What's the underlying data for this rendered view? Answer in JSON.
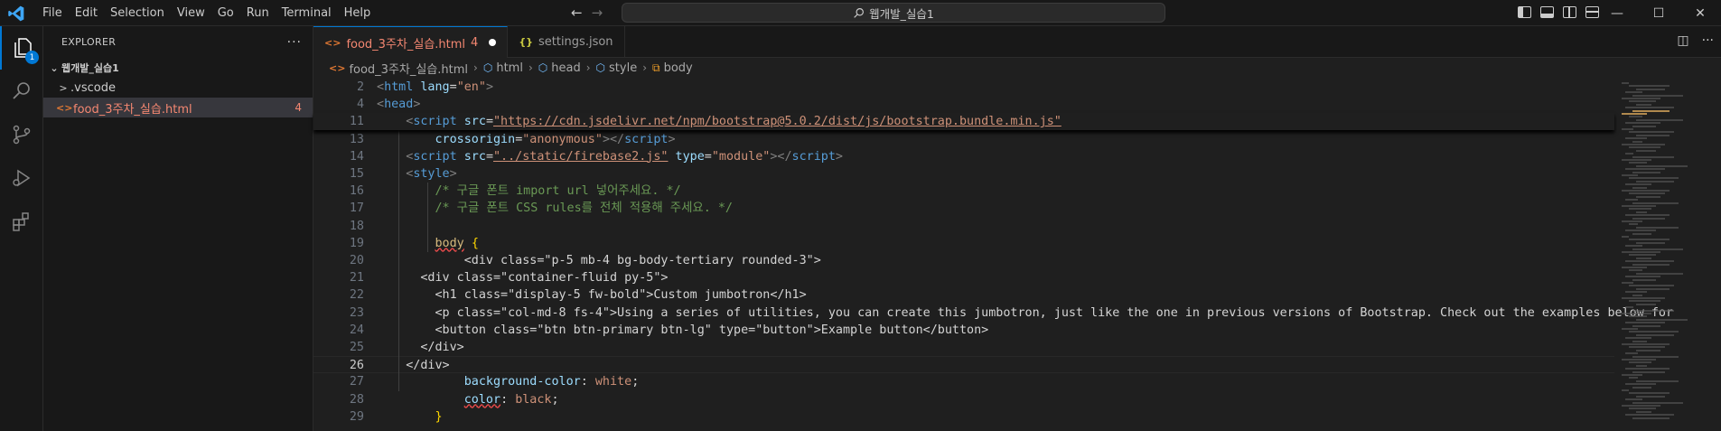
{
  "menu": [
    "File",
    "Edit",
    "Selection",
    "View",
    "Go",
    "Run",
    "Terminal",
    "Help"
  ],
  "search": {
    "label": "웹개발_실습1"
  },
  "window_controls": [
    "—",
    "☐",
    "✕"
  ],
  "activity": {
    "explorer_badge": "1"
  },
  "sidebar": {
    "title": "EXPLORER",
    "more": "···",
    "project": "웹개발_실습1",
    "items": [
      {
        "chevron": ">",
        "label": ".vscode",
        "count": ""
      },
      {
        "chevron": "<>",
        "label": "food_3주차_실습.html",
        "count": "4"
      }
    ]
  },
  "tabs": [
    {
      "icon": "<>",
      "label": "food_3주차_실습.html",
      "problems": "4"
    },
    {
      "icon": "{}",
      "label": "settings.json"
    }
  ],
  "breadcrumb": {
    "file": "food_3주차_실습.html",
    "parts": [
      "html",
      "head",
      "style",
      "body"
    ],
    "file_icon": "<>"
  },
  "editor": {
    "current_line": "26",
    "lines": [
      {
        "n": "2",
        "tokens": [
          [
            "t",
            "<"
          ],
          [
            "tag",
            "html"
          ],
          [
            "d",
            " "
          ],
          [
            "at",
            "lang"
          ],
          [
            "d",
            "="
          ],
          [
            "v",
            "\"en\""
          ],
          [
            "t",
            ">"
          ]
        ]
      },
      {
        "n": "4",
        "tokens": [
          [
            "t",
            "<"
          ],
          [
            "tag",
            "head"
          ],
          [
            "t",
            ">"
          ]
        ]
      },
      {
        "n": "11",
        "tokens": [
          [
            "d",
            "    "
          ],
          [
            "t",
            "<"
          ],
          [
            "tag",
            "script"
          ],
          [
            "d",
            " "
          ],
          [
            "at",
            "src"
          ],
          [
            "d",
            "="
          ],
          [
            "vl",
            "\"https://cdn.jsdelivr.net/npm/bootstrap@5.0.2/dist/js/bootstrap.bundle.min.js\""
          ]
        ]
      },
      {
        "n": "13",
        "tokens": [
          [
            "d",
            "        "
          ],
          [
            "at",
            "crossorigin"
          ],
          [
            "d",
            "="
          ],
          [
            "v",
            "\"anonymous\""
          ],
          [
            "t",
            "></"
          ],
          [
            "tag",
            "script"
          ],
          [
            "t",
            ">"
          ]
        ]
      },
      {
        "n": "14",
        "tokens": [
          [
            "d",
            "    "
          ],
          [
            "t",
            "<"
          ],
          [
            "tag",
            "script"
          ],
          [
            "d",
            " "
          ],
          [
            "at",
            "src"
          ],
          [
            "d",
            "="
          ],
          [
            "vl",
            "\"../static/firebase2.js\""
          ],
          [
            "d",
            " "
          ],
          [
            "at",
            "type"
          ],
          [
            "d",
            "="
          ],
          [
            "v",
            "\"module\""
          ],
          [
            "t",
            "></"
          ],
          [
            "tag",
            "script"
          ],
          [
            "t",
            ">"
          ]
        ]
      },
      {
        "n": "15",
        "tokens": [
          [
            "d",
            "    "
          ],
          [
            "t",
            "<"
          ],
          [
            "tag",
            "style"
          ],
          [
            "t",
            ">"
          ]
        ]
      },
      {
        "n": "16",
        "tokens": [
          [
            "d",
            "        "
          ],
          [
            "cm",
            "/* 구글 폰트 import url 넣어주세요. */"
          ]
        ]
      },
      {
        "n": "17",
        "tokens": [
          [
            "d",
            "        "
          ],
          [
            "cm",
            "/* 구글 폰트 CSS rules를 전체 적용해 주세요. */"
          ]
        ]
      },
      {
        "n": "18",
        "tokens": []
      },
      {
        "n": "19",
        "tokens": [
          [
            "d",
            "        "
          ],
          [
            "selq",
            "body"
          ],
          [
            "d",
            " "
          ],
          [
            "br",
            "{"
          ]
        ]
      },
      {
        "n": "20",
        "tokens": [
          [
            "d",
            "            <div class=\"p-5 mb-4 bg-body-tertiary rounded-3\">"
          ]
        ]
      },
      {
        "n": "21",
        "tokens": [
          [
            "d",
            "      <div class=\"container-fluid py-5\">"
          ]
        ]
      },
      {
        "n": "22",
        "tokens": [
          [
            "d",
            "        <h1 class=\"display-5 fw-bold\">Custom jumbotron</h1>"
          ]
        ]
      },
      {
        "n": "23",
        "tokens": [
          [
            "d",
            "        <p class=\"col-md-8 fs-4\">Using a series of utilities, you can create this jumbotron, just like the one in previous versions of Bootstrap. Check out the examples below for"
          ]
        ]
      },
      {
        "n": "24",
        "tokens": [
          [
            "d",
            "        <button class=\"btn btn-primary btn-lg\" type=\"button\">Example button</button>"
          ]
        ]
      },
      {
        "n": "25",
        "tokens": [
          [
            "d",
            "      </div>"
          ]
        ]
      },
      {
        "n": "26",
        "tokens": [
          [
            "d",
            "    </div>"
          ]
        ]
      },
      {
        "n": "27",
        "tokens": [
          [
            "d",
            "            "
          ],
          [
            "pr",
            "background-color"
          ],
          [
            "d",
            ": "
          ],
          [
            "v",
            "white"
          ],
          [
            "d",
            ";"
          ]
        ]
      },
      {
        "n": "28",
        "tokens": [
          [
            "d",
            "            "
          ],
          [
            "prq",
            "color"
          ],
          [
            "d",
            ": "
          ],
          [
            "v",
            "black"
          ],
          [
            "d",
            ";"
          ]
        ]
      },
      {
        "n": "29",
        "tokens": [
          [
            "d",
            "        "
          ],
          [
            "br",
            "}"
          ]
        ]
      }
    ]
  },
  "colors": {
    "accent": "#0078d4",
    "error": "#f48771"
  },
  "icons": [
    "vscode-logo-icon",
    "files-icon",
    "search-icon",
    "source-control-icon",
    "run-debug-icon",
    "extensions-icon"
  ]
}
